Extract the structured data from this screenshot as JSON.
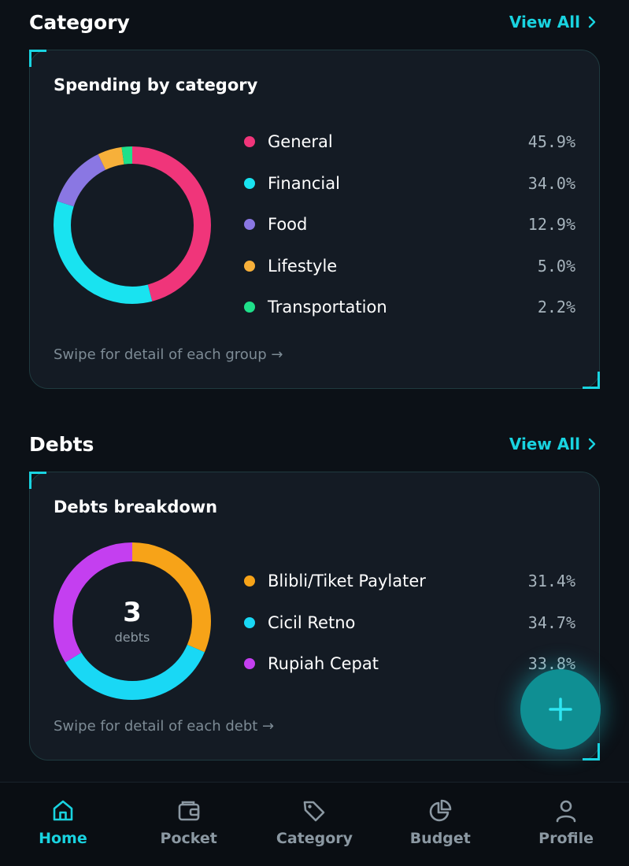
{
  "category_section": {
    "title": "Category",
    "view_all": "View All",
    "card_title": "Spending by category",
    "hint": "Swipe for detail of each group →",
    "items": [
      {
        "label": "General",
        "pct": "45.9%",
        "color": "#f0357a"
      },
      {
        "label": "Financial",
        "pct": "34.0%",
        "color": "#19e3f0"
      },
      {
        "label": "Food",
        "pct": "12.9%",
        "color": "#8a77e3"
      },
      {
        "label": "Lifestyle",
        "pct": "5.0%",
        "color": "#f7b03a"
      },
      {
        "label": "Transportation",
        "pct": "2.2%",
        "color": "#1fe08a"
      }
    ]
  },
  "debts_section": {
    "title": "Debts",
    "view_all": "View All",
    "card_title": "Debts breakdown",
    "center_count": "3",
    "center_label": "debts",
    "hint": "Swipe for detail of each debt →",
    "items": [
      {
        "label": "Blibli/Tiket Paylater",
        "pct": "31.4%",
        "color": "#f7a318"
      },
      {
        "label": "Cicil Retno",
        "pct": "34.7%",
        "color": "#19d8f5"
      },
      {
        "label": "Rupiah Cepat",
        "pct": "33.8%",
        "color": "#c43ff0"
      }
    ]
  },
  "fab": {
    "icon": "plus-icon"
  },
  "nav": [
    {
      "label": "Home",
      "icon": "home-icon",
      "active": true
    },
    {
      "label": "Pocket",
      "icon": "wallet-icon",
      "active": false
    },
    {
      "label": "Category",
      "icon": "tag-icon",
      "active": false
    },
    {
      "label": "Budget",
      "icon": "pie-chart-icon",
      "active": false
    },
    {
      "label": "Profile",
      "icon": "user-icon",
      "active": false
    }
  ],
  "colors": {
    "accent": "#19d3e0",
    "background": "#0c1117",
    "card": "#141b24"
  }
}
